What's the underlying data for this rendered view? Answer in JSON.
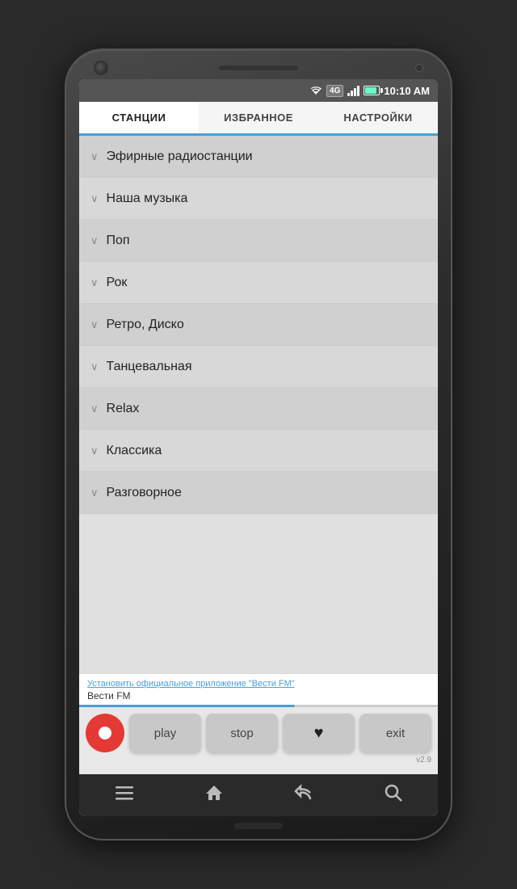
{
  "status_bar": {
    "time": "10:10 AM",
    "signal_label": "4G"
  },
  "tabs": [
    {
      "id": "stations",
      "label": "СТАНЦИИ",
      "active": true
    },
    {
      "id": "favorites",
      "label": "ИЗБРАННОЕ",
      "active": false
    },
    {
      "id": "settings",
      "label": "НАСТРОЙКИ",
      "active": false
    }
  ],
  "categories": [
    {
      "id": "air",
      "label": "Эфирные радиостанции"
    },
    {
      "id": "ourmusic",
      "label": "Наша музыка"
    },
    {
      "id": "pop",
      "label": "Поп"
    },
    {
      "id": "rock",
      "label": "Рок"
    },
    {
      "id": "retro",
      "label": "Ретро, Диско"
    },
    {
      "id": "dance",
      "label": "Танцевальная"
    },
    {
      "id": "relax",
      "label": "Relax"
    },
    {
      "id": "classic",
      "label": "Классика"
    },
    {
      "id": "talk",
      "label": "Разговорное"
    }
  ],
  "promo": {
    "link_text": "Установить официальное приложение \"Вести FM\"",
    "station_name": "Вести FM"
  },
  "controls": {
    "play_label": "play",
    "stop_label": "stop",
    "exit_label": "exit"
  },
  "version": "v2.9",
  "nav": {
    "menu_icon": "☰",
    "home_icon": "⌂",
    "back_icon": "↩",
    "search_icon": "⌕"
  }
}
